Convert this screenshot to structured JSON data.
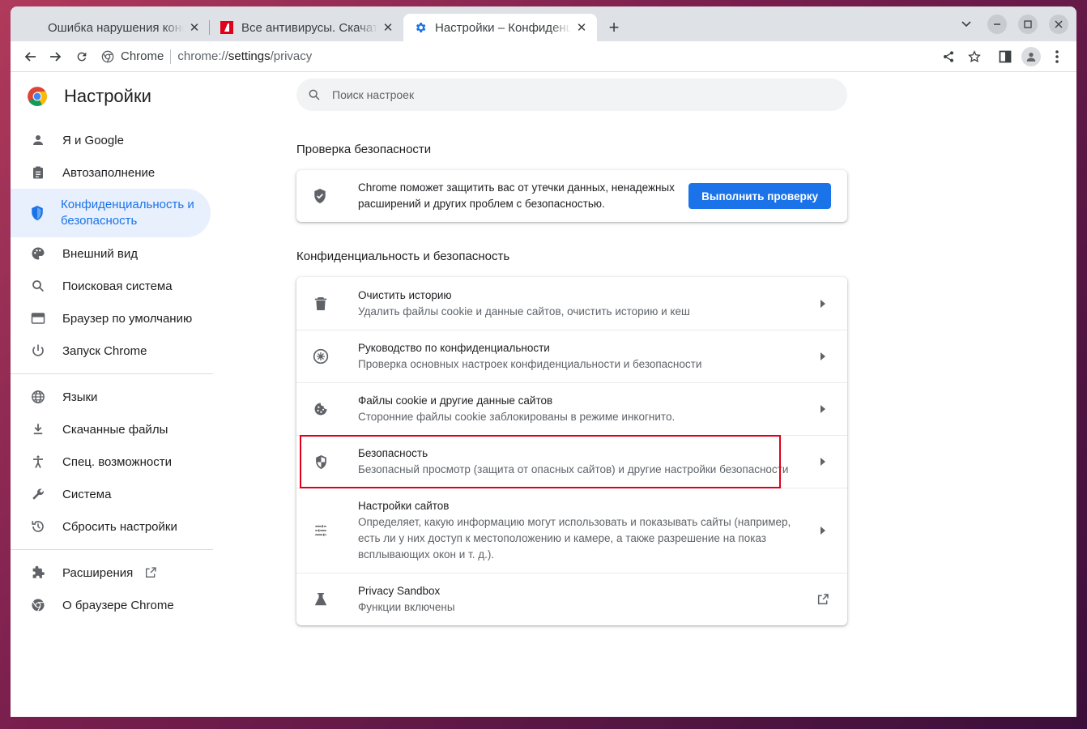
{
  "tabs": [
    {
      "title": "Ошибка нарушения конфиденциальности",
      "favicon": "blank",
      "active": false
    },
    {
      "title": "Все антивирусы. Скачать",
      "favicon": "antivirus-red",
      "active": false
    },
    {
      "title": "Настройки – Конфиденциальность",
      "favicon": "settings-gear",
      "active": true
    }
  ],
  "toolbar": {
    "site_chip": "Chrome",
    "url_prefix": "chrome://",
    "url_host": "settings",
    "url_path": "/privacy"
  },
  "settings": {
    "title": "Настройки",
    "search_placeholder": "Поиск настроек"
  },
  "sidebar": {
    "items": [
      {
        "label": "Я и Google",
        "icon": "person-icon"
      },
      {
        "label": "Автозаполнение",
        "icon": "clipboard-icon"
      },
      {
        "label": "Конфиденциальность и безопасность",
        "icon": "shield-icon",
        "selected": true
      },
      {
        "label": "Внешний вид",
        "icon": "palette-icon"
      },
      {
        "label": "Поисковая система",
        "icon": "search-icon"
      },
      {
        "label": "Браузер по умолчанию",
        "icon": "browser-icon"
      },
      {
        "label": "Запуск Chrome",
        "icon": "power-icon"
      },
      {
        "label": "Языки",
        "icon": "globe-icon"
      },
      {
        "label": "Скачанные файлы",
        "icon": "download-icon"
      },
      {
        "label": "Спец. возможности",
        "icon": "accessibility-icon"
      },
      {
        "label": "Система",
        "icon": "wrench-icon"
      },
      {
        "label": "Сбросить настройки",
        "icon": "restore-icon"
      },
      {
        "label": "Расширения",
        "icon": "puzzle-icon"
      },
      {
        "label": "О браузере Chrome",
        "icon": "chrome-icon"
      }
    ]
  },
  "safety_check": {
    "heading": "Проверка безопасности",
    "text": "Chrome поможет защитить вас от утечки данных, ненадежных расширений и других проблем с безопасностью.",
    "button": "Выполнить проверку"
  },
  "privacy": {
    "heading": "Конфиденциальность и безопасность",
    "rows": [
      {
        "title": "Очистить историю",
        "subtitle": "Удалить файлы cookie и данные сайтов, очистить историю и кеш",
        "icon": "trash-icon"
      },
      {
        "title": "Руководство по конфиденциальности",
        "subtitle": "Проверка основных настроек конфиденциальности и безопасности",
        "icon": "guide-icon"
      },
      {
        "title": "Файлы cookie и другие данные сайтов",
        "subtitle": "Сторонние файлы cookie заблокированы в режиме инкогнито.",
        "icon": "cookie-icon"
      },
      {
        "title": "Безопасность",
        "subtitle": "Безопасный просмотр (защита от опасных сайтов) и другие настройки безопасности",
        "icon": "security-shield-icon",
        "highlighted": true
      },
      {
        "title": "Настройки сайтов",
        "subtitle": "Определяет, какую информацию могут использовать и показывать сайты (например, есть ли у них доступ к местоположению и камере, а также разрешение на показ всплывающих окон и т. д.).",
        "icon": "tune-icon"
      },
      {
        "title": "Privacy Sandbox",
        "subtitle": "Функции включены",
        "icon": "flask-icon",
        "external": true
      }
    ]
  },
  "colors": {
    "accent": "#1a73e8",
    "highlight_box": "#e0001b",
    "selected_bg": "#e8f0fe"
  }
}
